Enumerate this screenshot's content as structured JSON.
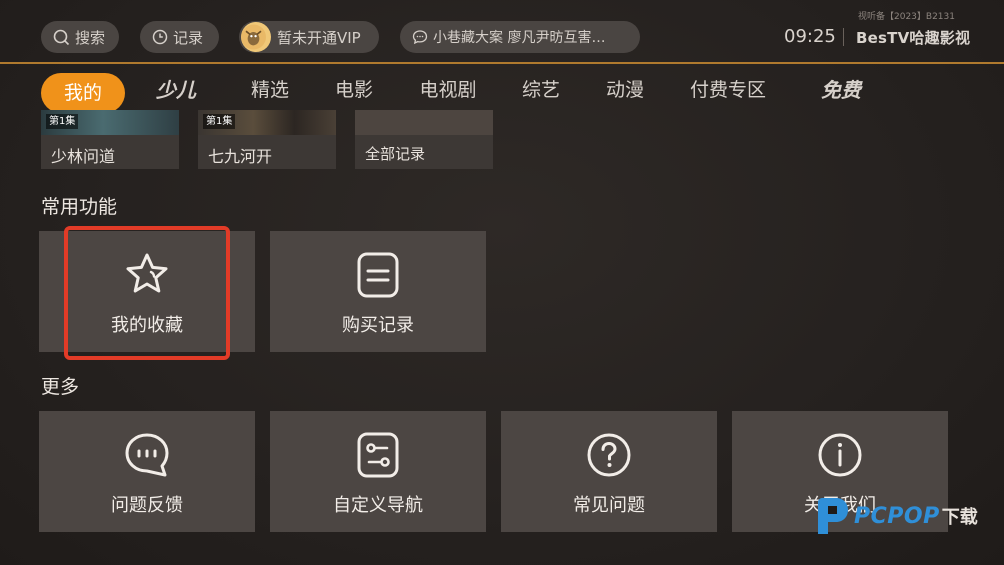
{
  "top_bar": {
    "search_label": "搜索",
    "record_label": "记录",
    "vip_label": "暂未开通VIP",
    "message_text": "小巷藏大案 廖凡尹昉互害…",
    "time": "09:25",
    "brand": "BesTV哈趣影视",
    "license": "视听备【2023】B2131"
  },
  "nav": {
    "tabs": [
      {
        "label": "我的"
      },
      {
        "label": "少儿"
      },
      {
        "label": "精选"
      },
      {
        "label": "电影"
      },
      {
        "label": "电视剧"
      },
      {
        "label": "综艺"
      },
      {
        "label": "动漫"
      },
      {
        "label": "付费专区"
      },
      {
        "label": "免费"
      }
    ]
  },
  "history": {
    "items": [
      {
        "episode": "第1集",
        "title": "少林问道"
      },
      {
        "episode": "第1集",
        "title": "七九河开"
      },
      {
        "title": "全部记录"
      }
    ]
  },
  "common_functions": {
    "title": "常用功能",
    "items": [
      {
        "label": "我的收藏",
        "icon": "star-icon"
      },
      {
        "label": "购买记录",
        "icon": "receipt-icon"
      }
    ]
  },
  "more": {
    "title": "更多",
    "items": [
      {
        "label": "问题反馈",
        "icon": "chat-bubble-icon"
      },
      {
        "label": "自定义导航",
        "icon": "sliders-icon"
      },
      {
        "label": "常见问题",
        "icon": "question-icon"
      },
      {
        "label": "关于我们",
        "icon": "info-icon"
      }
    ]
  },
  "watermark": {
    "text": "PCPOP",
    "suffix": "下载"
  },
  "colors": {
    "accent": "#f0921a",
    "focus": "#e23b27",
    "card": "#4c4643",
    "watermark": "#2f8fd8"
  }
}
